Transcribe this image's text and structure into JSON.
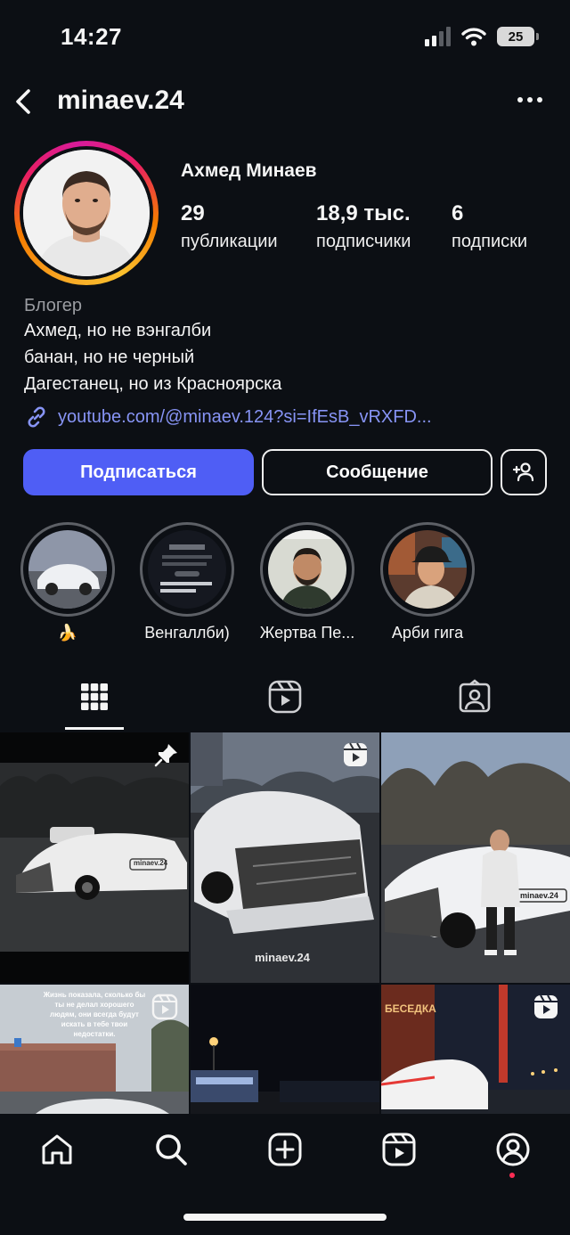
{
  "status_bar": {
    "time": "14:27",
    "battery": "25"
  },
  "header": {
    "username": "minaev.24"
  },
  "profile": {
    "full_name": "Ахмед Минаев",
    "stats": {
      "posts": {
        "value": "29",
        "label": "публикации"
      },
      "followers": {
        "value": "18,9 тыс.",
        "label": "подписчики"
      },
      "following": {
        "value": "6",
        "label": "подписки"
      }
    },
    "bio": {
      "category": "Блогер",
      "lines": [
        "Ахмед, но не вэнгалби",
        "банан, но не черный",
        "Дагестанец, но из Красноярска"
      ],
      "link": "youtube.com/@minaev.124?si=IfEsB_vRXFD..."
    }
  },
  "actions": {
    "follow": "Подписаться",
    "message": "Сообщение"
  },
  "highlights": [
    {
      "label": "🍌"
    },
    {
      "label": "Венгаллби)"
    },
    {
      "label": "Жертва Пе..."
    },
    {
      "label": "Арби гига"
    }
  ],
  "grid": {
    "posts": [
      {
        "overlay_text": "minaev.24",
        "badge": "pin-icon"
      },
      {
        "overlay_text": "minaev.24",
        "badge": "reels-icon"
      },
      {
        "overlay_text": "minaev.24",
        "badge": ""
      },
      {
        "overlay_text": "Жизнь показала, сколько бы ты не делал хорошего людям, они всегда будут искать в тебе твои недостатки.",
        "badge": "reels-icon"
      },
      {
        "overlay_text": "",
        "badge": ""
      },
      {
        "overlay_text": "БЕСЕДКА",
        "badge": "reels-icon"
      }
    ]
  },
  "colors": {
    "background": "#0c0f14",
    "accent": "#4f5ef5",
    "link": "#8794f5",
    "notification": "#ff2d55"
  }
}
